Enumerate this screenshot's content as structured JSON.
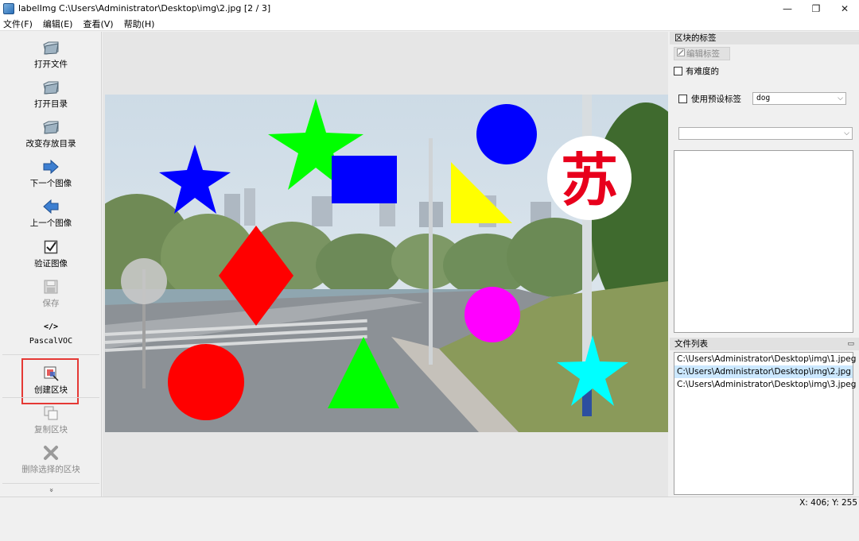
{
  "window": {
    "title": "labelImg C:\\Users\\Administrator\\Desktop\\img\\2.jpg [2 / 3]",
    "controls": {
      "minimize": "—",
      "maximize": "❐",
      "close": "✕"
    }
  },
  "menu": [
    "文件(F)",
    "编辑(E)",
    "查看(V)",
    "帮助(H)"
  ],
  "toolbar": {
    "open_file": "打开文件",
    "open_dir": "打开目录",
    "change_save_dir": "改变存放目录",
    "next_image": "下一个图像",
    "prev_image": "上一个图像",
    "verify_image": "验证图像",
    "save": "保存",
    "format_icon": "</>",
    "format": "PascalVOC",
    "create_box": "创建区块",
    "duplicate_box": "复制区块",
    "delete_box": "删除选择的区块",
    "more": "»"
  },
  "canvas": {
    "character": "苏",
    "accent_colors": {
      "red": "#ff0000",
      "green": "#00ff00",
      "blue": "#0000ff",
      "yellow": "#ffff00",
      "magenta": "#ff00ff",
      "cyan": "#00ffff"
    }
  },
  "box_labels": {
    "title": "区块的标签",
    "edit_label": "编辑标签",
    "difficult": "有难度的",
    "use_default": "使用预设标签",
    "default_value": "dog",
    "second_value": ""
  },
  "files": {
    "title": "文件列表",
    "items": [
      "C:\\Users\\Administrator\\Desktop\\img\\1.jpeg",
      "C:\\Users\\Administrator\\Desktop\\img\\2.jpg",
      "C:\\Users\\Administrator\\Desktop\\img\\3.jpeg"
    ],
    "selected_index": 1
  },
  "status": "X: 406; Y: 255"
}
